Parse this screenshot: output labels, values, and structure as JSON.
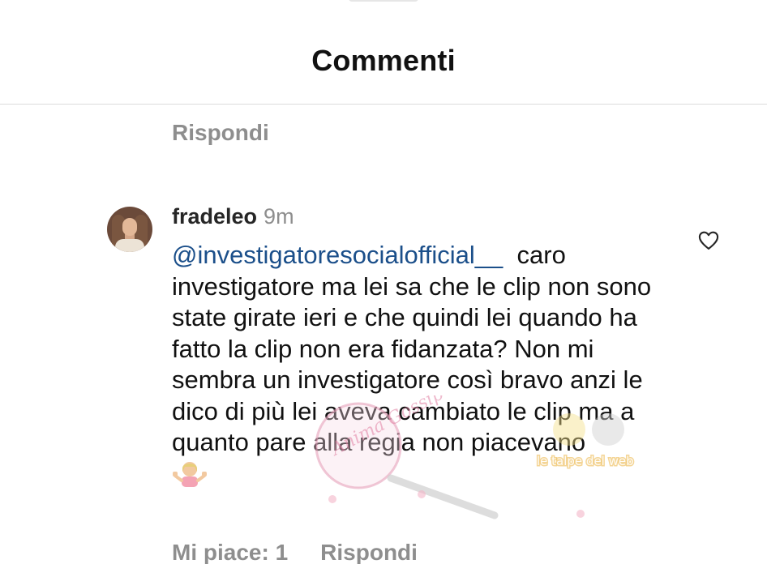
{
  "header": {
    "title": "Commenti"
  },
  "previous_comment": {
    "reply_label": "Rispondi"
  },
  "comment": {
    "username": "fradeleo",
    "time": "9m",
    "mention": "@investigatoresocialofficial__",
    "text": "caro investigatore ma lei sa che le clip non sono state girate ieri e che quindi lei quando ha fatto la clip non era fidanzata? Non mi sembra un investigatore così bravo anzi le dico di più lei aveva cambiato le clip ma a quanto pare alla regia non piacevano",
    "emoji_icon": "person-shrugging-emoji",
    "likes_label": "Mi piace: 1",
    "reply_label": "Rispondi"
  },
  "watermark": {
    "text_a": "Anima Gossip",
    "text_b": "le talpe del web"
  },
  "colors": {
    "mention": "#1b4f8a",
    "muted": "#8e8e8e",
    "text": "#111111"
  }
}
